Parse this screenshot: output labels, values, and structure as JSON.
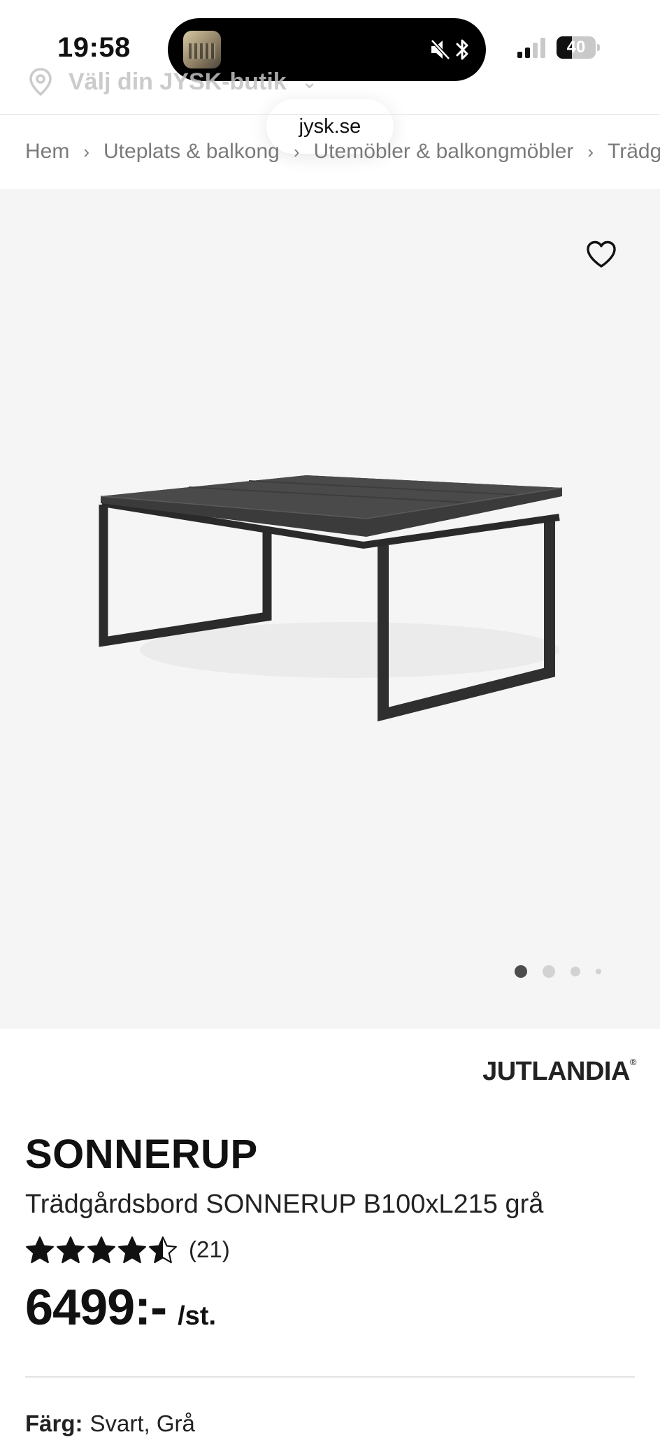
{
  "status_bar": {
    "time": "19:58",
    "battery_level": "40",
    "battery_fraction": 0.4
  },
  "store_selector": {
    "label": "Välj din JYSK-butik"
  },
  "browser": {
    "url": "jysk.se"
  },
  "breadcrumb": [
    {
      "label": "Hem"
    },
    {
      "label": "Uteplats & balkong"
    },
    {
      "label": "Utemöbler & balkongmöbler"
    },
    {
      "label": "Trädgårdsbord"
    }
  ],
  "gallery": {
    "image_count": 4,
    "active_index": 0
  },
  "product": {
    "brand": "JUTLANDIA",
    "brand_mark": "®",
    "name": "SONNERUP",
    "description": "Trädgårdsbord SONNERUP B100xL215 grå",
    "rating": 4.5,
    "review_count": "(21)",
    "price": "6499:-",
    "unit": "/st.",
    "color_label": "Färg:",
    "color_value": "Svart, Grå"
  },
  "icons": {
    "location": "location-pin-icon",
    "wishlist": "heart-icon",
    "mute": "speaker-muted-icon",
    "bluetooth": "bluetooth-icon"
  },
  "colors": {
    "gallery_bg": "#f5f5f5",
    "text": "#111111",
    "muted": "#7a7a7a"
  }
}
